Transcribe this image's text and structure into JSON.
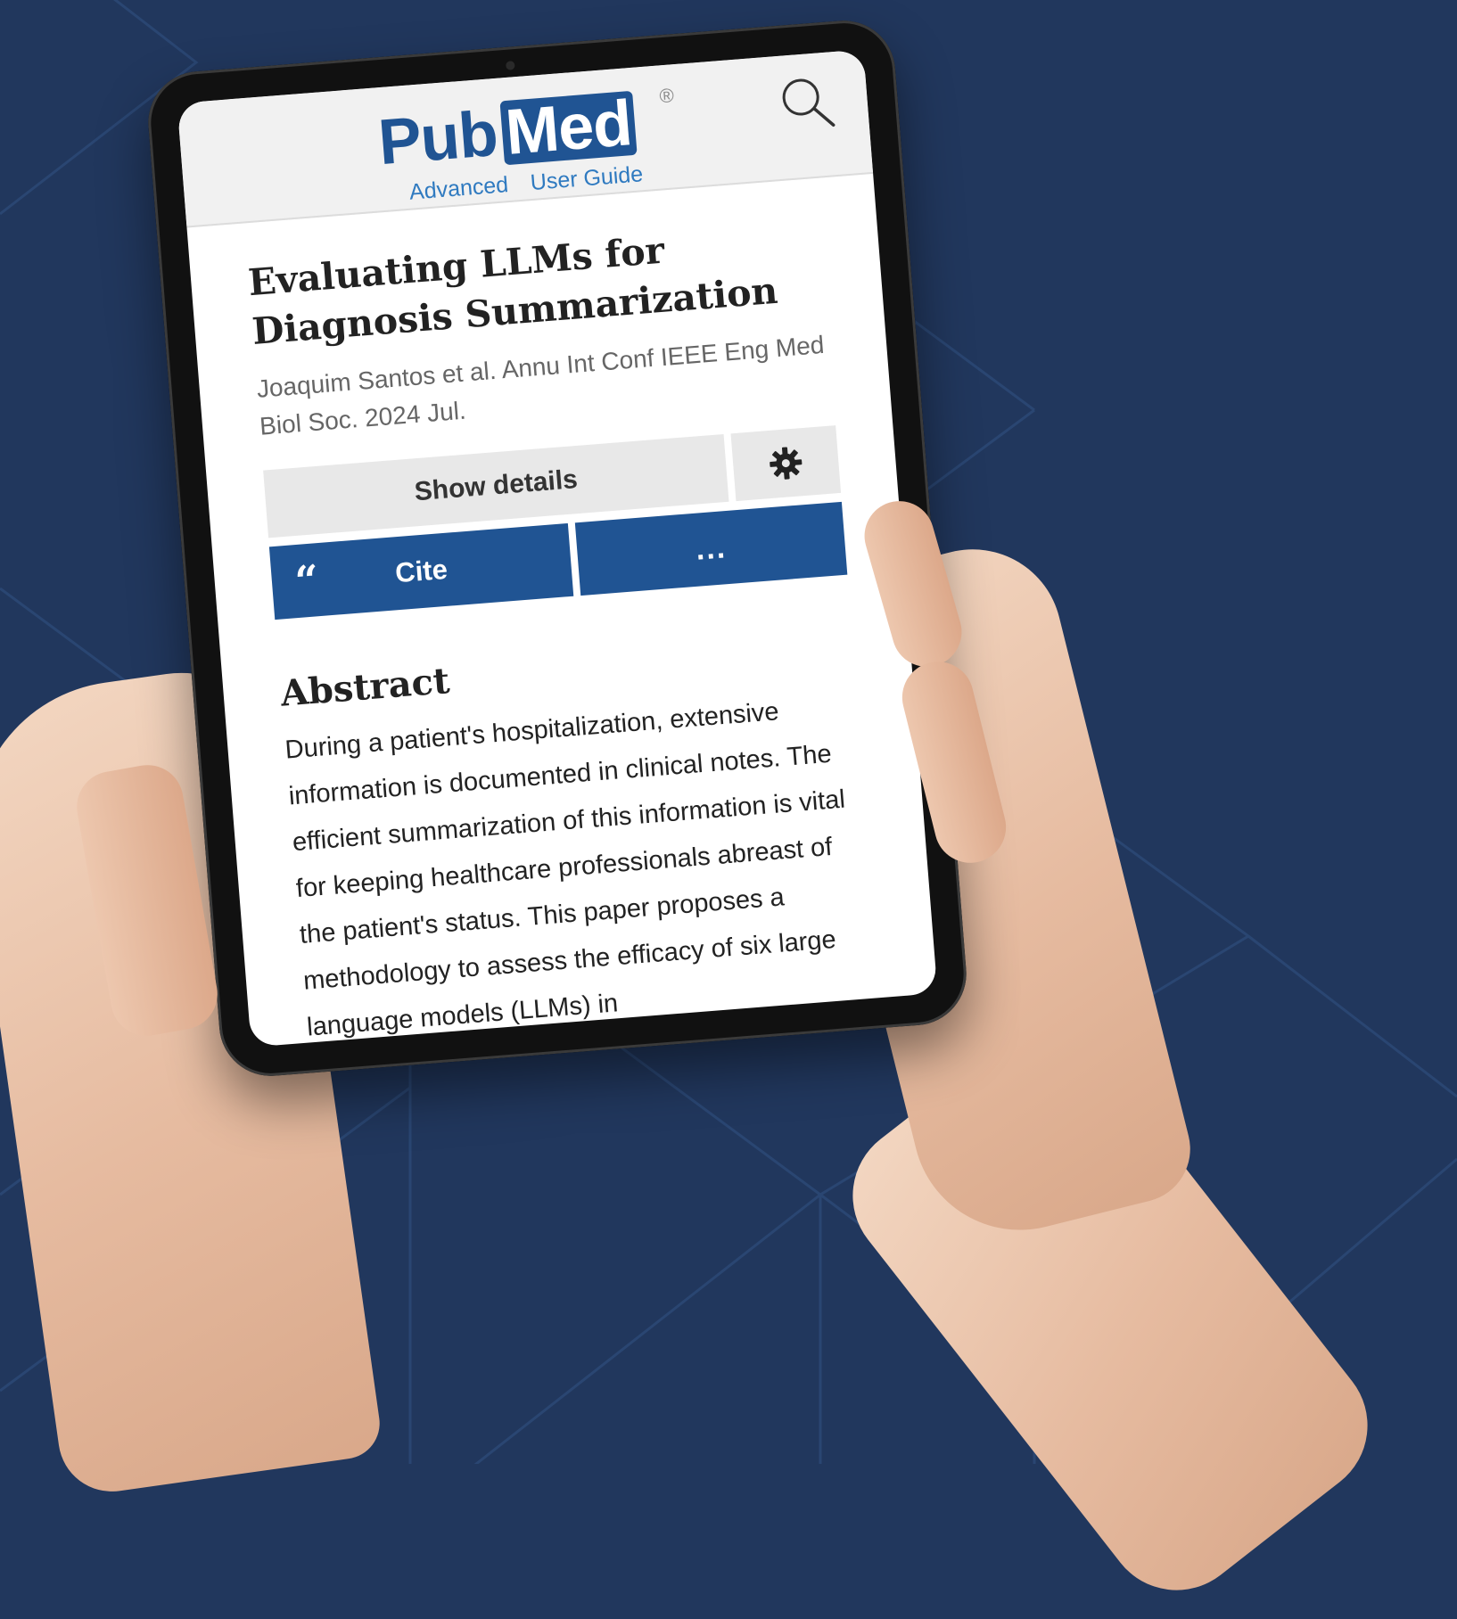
{
  "header": {
    "logo_word_pub": "Pub",
    "logo_word_med": "Med",
    "logo_registered": "®",
    "links": [
      "Advanced",
      "User Guide"
    ],
    "search_icon": "search-icon"
  },
  "article": {
    "title": "Evaluating LLMs for Diagnosis Summarization",
    "authors": "Joaquim Santos et al. Annu Int Conf IEEE Eng Med Biol Soc. 2024 Jul."
  },
  "actions": {
    "show_details": "Show details",
    "settings_icon": "gear-icon",
    "cite_quote": "“",
    "cite": "Cite",
    "more": "..."
  },
  "abstract": {
    "heading": "Abstract",
    "text": "During a patient's hospitalization, extensive information is documented in clinical notes. The efficient summarization of this information is vital for keeping healthcare professionals abreast of the patient's status. This paper proposes a methodology to assess the efficacy of six large language models (LLMs) in"
  },
  "colors": {
    "background": "#21375d",
    "brand_blue": "#205493",
    "link_blue": "#2f7ac0"
  }
}
